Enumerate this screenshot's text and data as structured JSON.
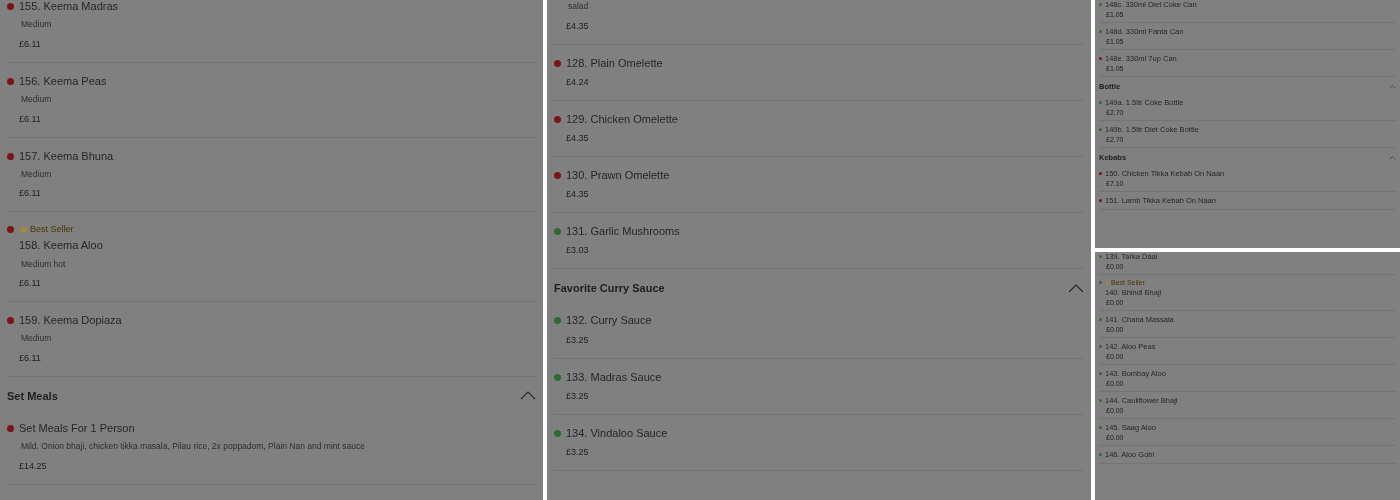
{
  "panels": [
    {
      "kind": "full",
      "entries": [
        {
          "kind": "item",
          "name": "155. Keema Madras",
          "description": "Medium",
          "price": "£6.11",
          "color": "#7a1515"
        },
        {
          "kind": "item",
          "name": "156. Keema Peas",
          "description": "Medium",
          "price": "£6.11",
          "color": "#7a1515"
        },
        {
          "kind": "item",
          "name": "157. Keema Bhuna",
          "description": "Medium",
          "price": "£6.11",
          "color": "#7a1515"
        },
        {
          "kind": "item",
          "badge": "Best Seller",
          "name": "158. Keema Aloo",
          "description": "Medium hot",
          "price": "£6.11",
          "color": "#7a1515"
        },
        {
          "kind": "item",
          "name": "159. Keema Dopiaza",
          "description": "Medium",
          "price": "£6.11",
          "color": "#7a1515"
        },
        {
          "kind": "section",
          "title": "Set Meals",
          "expanded": true
        },
        {
          "kind": "item",
          "name": "Set Meals For 1 Person",
          "description": "Mild. Onion bhaji, chicken tikka masala, Pilau rice, 2x poppadom, Plain Nan and mint sauce",
          "price": "£14.25",
          "color": "#7a1515"
        }
      ]
    },
    {
      "kind": "full",
      "entries": [
        {
          "kind": "item",
          "description": "salad",
          "price": "£4.35"
        },
        {
          "kind": "item",
          "name": "128. Plain Omelette",
          "price": "£4.24",
          "color": "#7a1515"
        },
        {
          "kind": "item",
          "name": "129. Chicken Omelette",
          "price": "£4.35",
          "color": "#7a1515"
        },
        {
          "kind": "item",
          "name": "130. Prawn Omelette",
          "price": "£4.35",
          "color": "#7a1515"
        },
        {
          "kind": "item",
          "name": "131. Garlic Mushrooms",
          "price": "£3.03",
          "color": "#2f6b30"
        },
        {
          "kind": "section",
          "title": "Favorite Curry Sauce",
          "expanded": true
        },
        {
          "kind": "item",
          "name": "132. Curry Sauce",
          "price": "£3.25",
          "color": "#2f6b30"
        },
        {
          "kind": "item",
          "name": "133. Madras Sauce",
          "price": "£3.25",
          "color": "#2f6b30"
        },
        {
          "kind": "item",
          "name": "134. Vindaloo Sauce",
          "price": "£3.25",
          "color": "#2f6b30"
        }
      ]
    },
    {
      "kind": "mini",
      "entries": [
        {
          "kind": "item",
          "name": "148c. 330ml Diet Coke Can",
          "price": "£1.05",
          "color": "#2f6b30"
        },
        {
          "kind": "item",
          "name": "148d. 330ml Fanta Can",
          "price": "£1.05",
          "color": "#2f6b30"
        },
        {
          "kind": "item",
          "name": "148e. 330ml 7up Can",
          "price": "£1.05",
          "color": "#7a1515"
        },
        {
          "kind": "section",
          "title": "Bottle",
          "expanded": true
        },
        {
          "kind": "item",
          "name": "149a. 1.5ltr Coke Bottle",
          "price": "£2.70",
          "color": "#2f6b30"
        },
        {
          "kind": "item",
          "name": "149b. 1.5ltr Diet Coke Bottle",
          "price": "£2.70",
          "color": "#2f6b30"
        },
        {
          "kind": "section",
          "title": "Kebabs",
          "expanded": true
        },
        {
          "kind": "item",
          "name": "150. Chicken Tikka Kebab On Naan",
          "price": "£7.10",
          "color": "#7a1515"
        },
        {
          "kind": "item",
          "name": "151. Lamb Tikka Kebab On Naan",
          "color": "#7a1515"
        }
      ]
    },
    {
      "kind": "mini",
      "entries": [
        {
          "kind": "item",
          "name": "139. Tarka Daal",
          "price": "£0.00",
          "color": "#2f6b30"
        },
        {
          "kind": "item",
          "badge": "Best Seller",
          "name": "140. Bhindi Bhaji",
          "price": "£0.00",
          "color": "#2f6b30"
        },
        {
          "kind": "item",
          "name": "141. Chana Massala",
          "price": "£0.00",
          "color": "#2f6b30"
        },
        {
          "kind": "item",
          "name": "142. Aloo Peas",
          "price": "£0.00",
          "color": "#2f6b30"
        },
        {
          "kind": "item",
          "name": "143. Bombay Aloo",
          "price": "£0.00",
          "color": "#2f6b30"
        },
        {
          "kind": "item",
          "name": "144. Cauliflower Bhaji",
          "price": "£0.00",
          "color": "#2f6b30"
        },
        {
          "kind": "item",
          "name": "145. Saag Aloo",
          "price": "£0.00",
          "color": "#2f6b30"
        },
        {
          "kind": "item",
          "name": "146. Aloo Gobi",
          "color": "#2f6b30"
        }
      ]
    }
  ]
}
